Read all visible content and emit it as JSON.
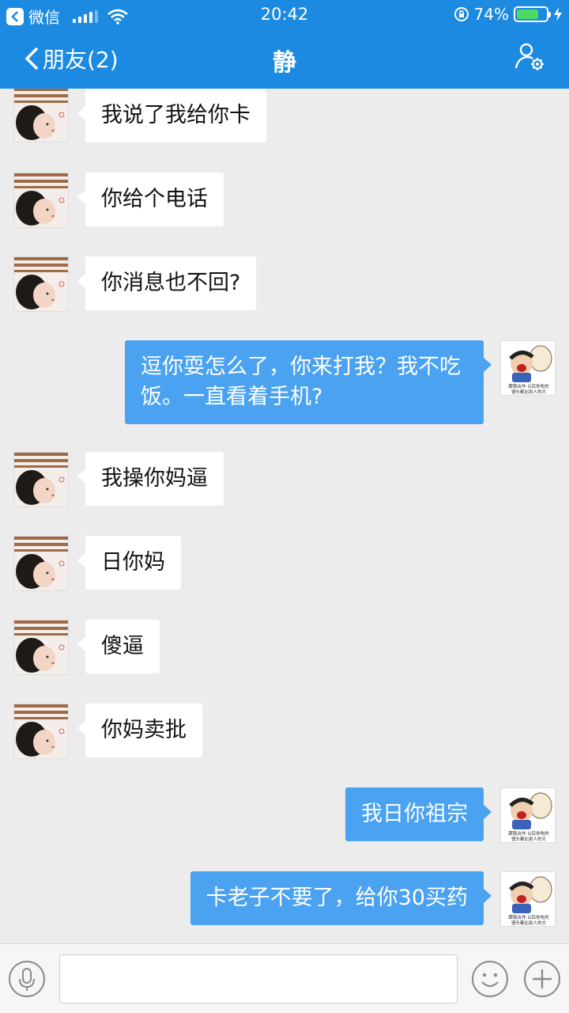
{
  "status_bar": {
    "carrier": "微信",
    "time": "20:42",
    "battery": "74%",
    "battery_level": 0.74
  },
  "nav": {
    "back_label": "朋友(2)",
    "title": "静"
  },
  "messages": [
    {
      "side": "in",
      "text": "我说了我给你卡"
    },
    {
      "side": "in",
      "text": "你给个电话"
    },
    {
      "side": "in",
      "text": "你消息也不回?"
    },
    {
      "side": "out",
      "text": "逗你耍怎么了，你来打我？我不吃饭。一直看着手机?"
    },
    {
      "side": "in",
      "text": "我操你妈逼"
    },
    {
      "side": "in",
      "text": "日你妈"
    },
    {
      "side": "in",
      "text": "傻逼"
    },
    {
      "side": "in",
      "text": "你妈卖批"
    },
    {
      "side": "out",
      "text": "我日你祖宗"
    },
    {
      "side": "out",
      "text": "卡老子不要了，给你30买药"
    }
  ],
  "sticker_caption": "跟我合作 以后你吃的馒头都比别人的大",
  "colors": {
    "brand_blue": "#1c8ae0",
    "bubble_out": "#4aa2f0",
    "bubble_in": "#ffffff",
    "background": "#ececec"
  }
}
